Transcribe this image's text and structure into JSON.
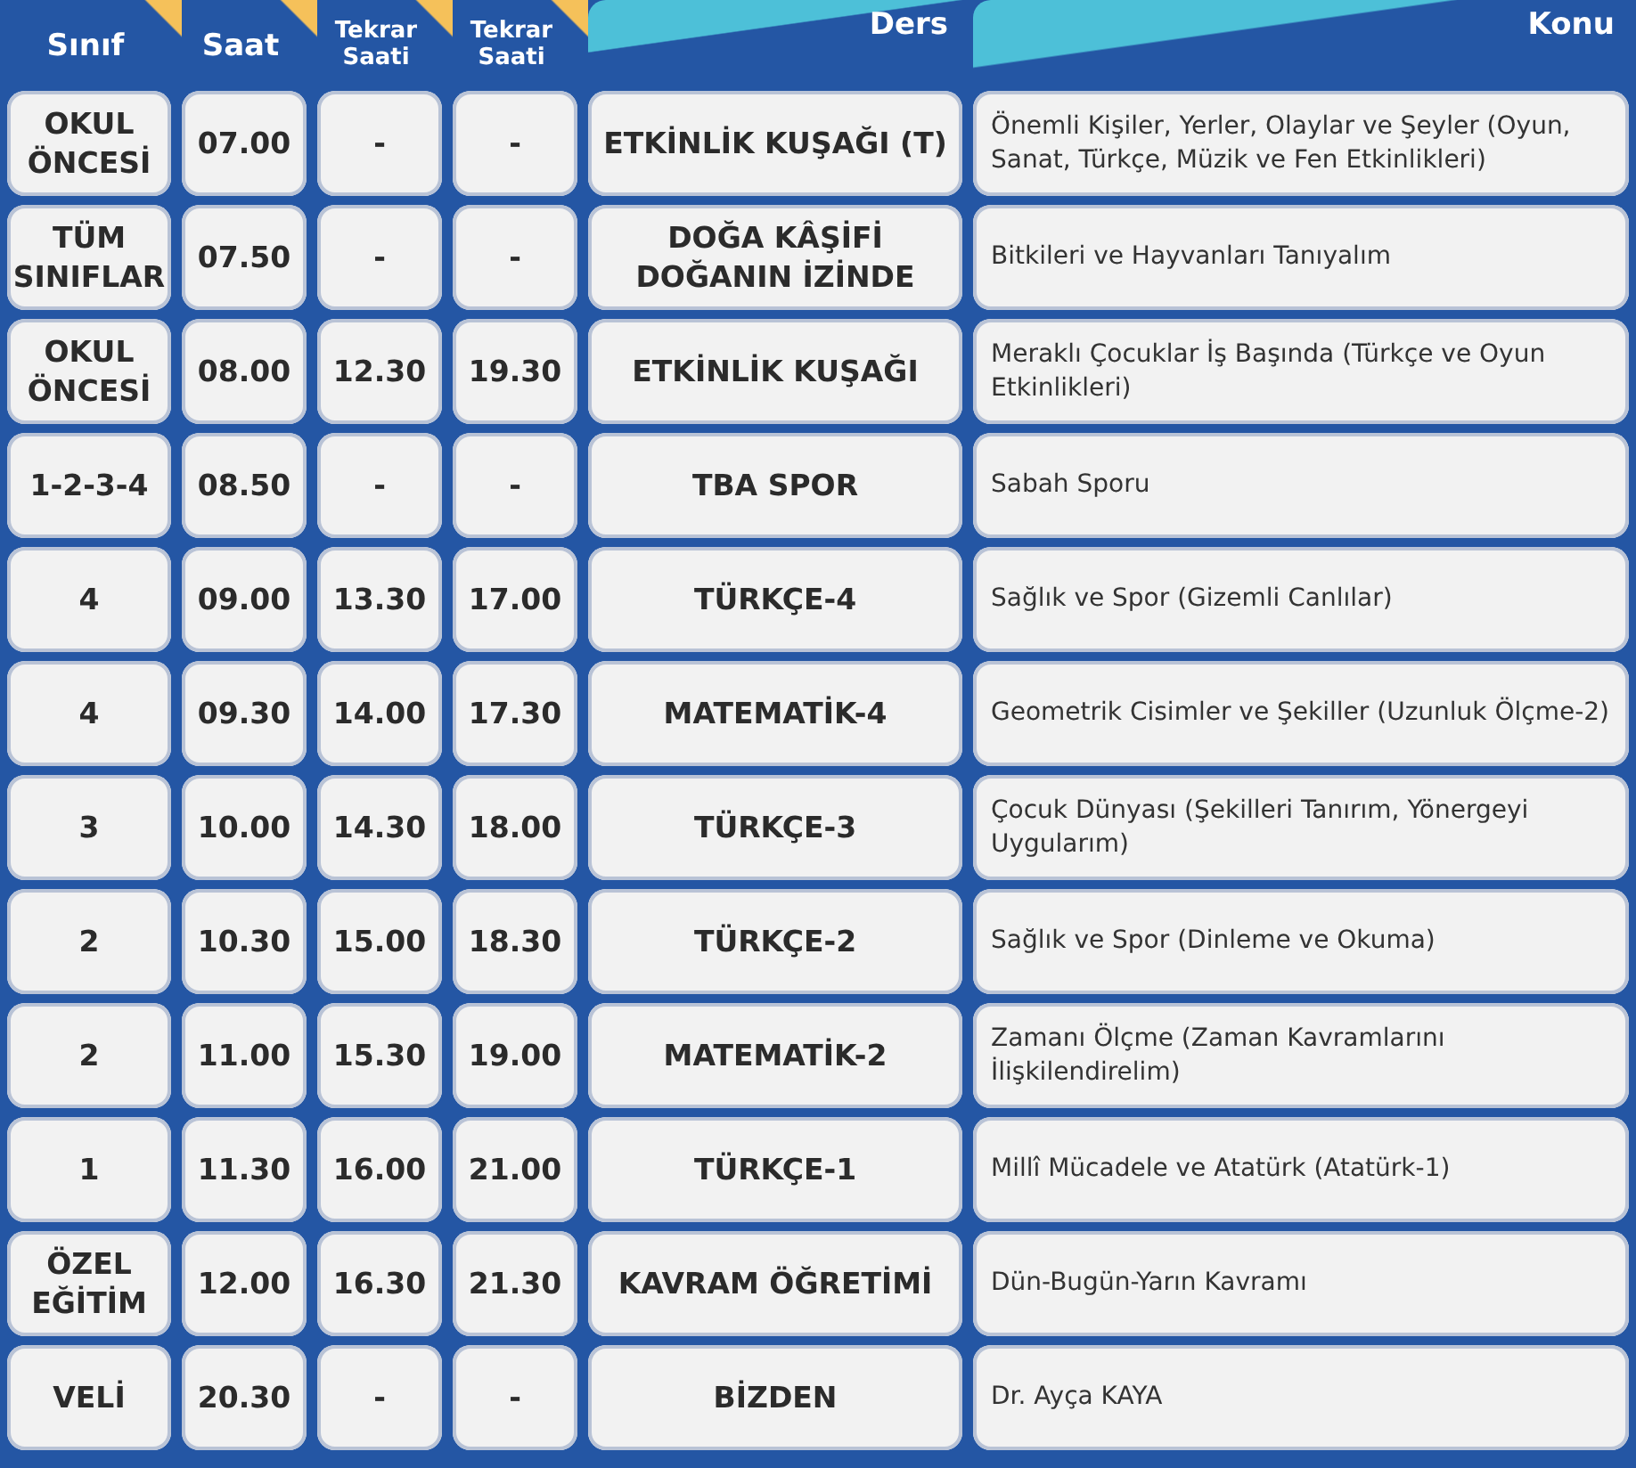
{
  "header": [
    "Sınıf",
    "Saat",
    "Tekrar Saati",
    "Tekrar Saati",
    "Ders",
    "Konu"
  ],
  "rows": [
    {
      "sinif": "OKUL ÖNCESİ",
      "saat": "07.00",
      "tekrar_1": "-",
      "tekrar_2": "-",
      "ders": "ETKİNLİK KUŞAĞI (T)",
      "konu": "Önemli Kişiler, Yerler, Olaylar ve Şeyler (Oyun, Sanat, Türkçe, Müzik ve Fen Etkinlikleri)"
    },
    {
      "sinif": "TÜM SINIFLAR",
      "saat": "07.50",
      "tekrar_1": "-",
      "tekrar_2": "-",
      "ders": "DOĞA KÂŞİFİ DOĞANIN İZİNDE",
      "konu": "Bitkileri ve Hayvanları Tanıyalım"
    },
    {
      "sinif": "OKUL ÖNCESİ",
      "saat": "08.00",
      "tekrar_1": "12.30",
      "tekrar_2": "19.30",
      "ders": "ETKİNLİK KUŞAĞI",
      "konu": "Meraklı Çocuklar İş Başında (Türkçe ve Oyun Etkinlikleri)"
    },
    {
      "sinif": "1-2-3-4",
      "saat": "08.50",
      "tekrar_1": "-",
      "tekrar_2": "-",
      "ders": "TBA SPOR",
      "konu": "Sabah Sporu"
    },
    {
      "sinif": "4",
      "saat": "09.00",
      "tekrar_1": "13.30",
      "tekrar_2": "17.00",
      "ders": "TÜRKÇE-4",
      "konu": "Sağlık ve Spor (Gizemli Canlılar)"
    },
    {
      "sinif": "4",
      "saat": "09.30",
      "tekrar_1": "14.00",
      "tekrar_2": "17.30",
      "ders": "MATEMATİK-4",
      "konu": "Geometrik Cisimler ve Şekiller (Uzunluk Ölçme-2)"
    },
    {
      "sinif": "3",
      "saat": "10.00",
      "tekrar_1": "14.30",
      "tekrar_2": "18.00",
      "ders": "TÜRKÇE-3",
      "konu": "Çocuk Dünyası (Şekilleri Tanırım, Yönergeyi Uygularım)"
    },
    {
      "sinif": "2",
      "saat": "10.30",
      "tekrar_1": "15.00",
      "tekrar_2": "18.30",
      "ders": "TÜRKÇE-2",
      "konu": "Sağlık ve Spor (Dinleme ve Okuma)"
    },
    {
      "sinif": "2",
      "saat": "11.00",
      "tekrar_1": "15.30",
      "tekrar_2": "19.00",
      "ders": "MATEMATİK-2",
      "konu": "Zamanı Ölçme (Zaman Kavramlarını İlişkilendirelim)"
    },
    {
      "sinif": "1",
      "saat": "11.30",
      "tekrar_1": "16.00",
      "tekrar_2": "21.00",
      "ders": "TÜRKÇE-1",
      "konu": "Millî Mücadele ve Atatürk (Atatürk-1)"
    },
    {
      "sinif": "ÖZEL EĞİTİM",
      "saat": "12.00",
      "tekrar_1": "16.30",
      "tekrar_2": "21.30",
      "ders": "KAVRAM ÖĞRETİMİ",
      "konu": "Dün-Bugün-Yarın Kavramı"
    },
    {
      "sinif": "VELİ",
      "saat": "20.30",
      "tekrar_1": "-",
      "tekrar_2": "-",
      "ders": "BİZDEN",
      "konu": "Dr. Ayça KAYA"
    }
  ]
}
